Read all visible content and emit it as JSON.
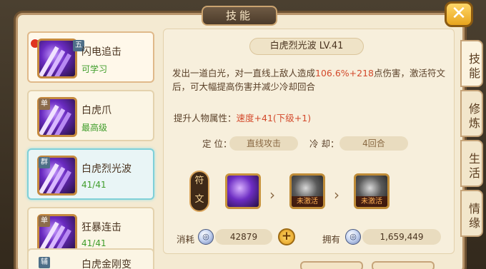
{
  "window": {
    "title": "技能",
    "close_label": "✕"
  },
  "skills": [
    {
      "tag": "五",
      "name": "闪电追击",
      "status": "可学习",
      "has_notice": true
    },
    {
      "tag": "单",
      "name": "白虎爪",
      "status": "最高级"
    },
    {
      "tag": "群",
      "name": "白虎烈光波",
      "status": "41/41"
    },
    {
      "tag": "单",
      "name": "狂暴连击",
      "status": "41/41"
    },
    {
      "tag": "辅",
      "name": "白虎金刚变",
      "status": ""
    }
  ],
  "detail": {
    "title": "白虎烈光波 LV.41",
    "desc_part1": "发出一道白光，对一直线上敌人造成",
    "desc_hl": "106.6%+218",
    "desc_part2": "点伤害，激活符文后，可大幅提高伤害并减少冷却回合",
    "attr_label": "提升人物属性：",
    "attr_value": "速度+41(下级+1)",
    "position_label": "定  位：",
    "position_value": "直线攻击",
    "cooldown_label": "冷  却：",
    "cooldown_value": "4回合",
    "rune_label": "符文",
    "rune_inactive_label": "未激活",
    "cost_label": "消耗",
    "cost_value": "42879",
    "own_label": "拥有",
    "own_value": "1,659,449"
  },
  "side_tabs": [
    "技能",
    "修炼",
    "生活",
    "情缘"
  ]
}
